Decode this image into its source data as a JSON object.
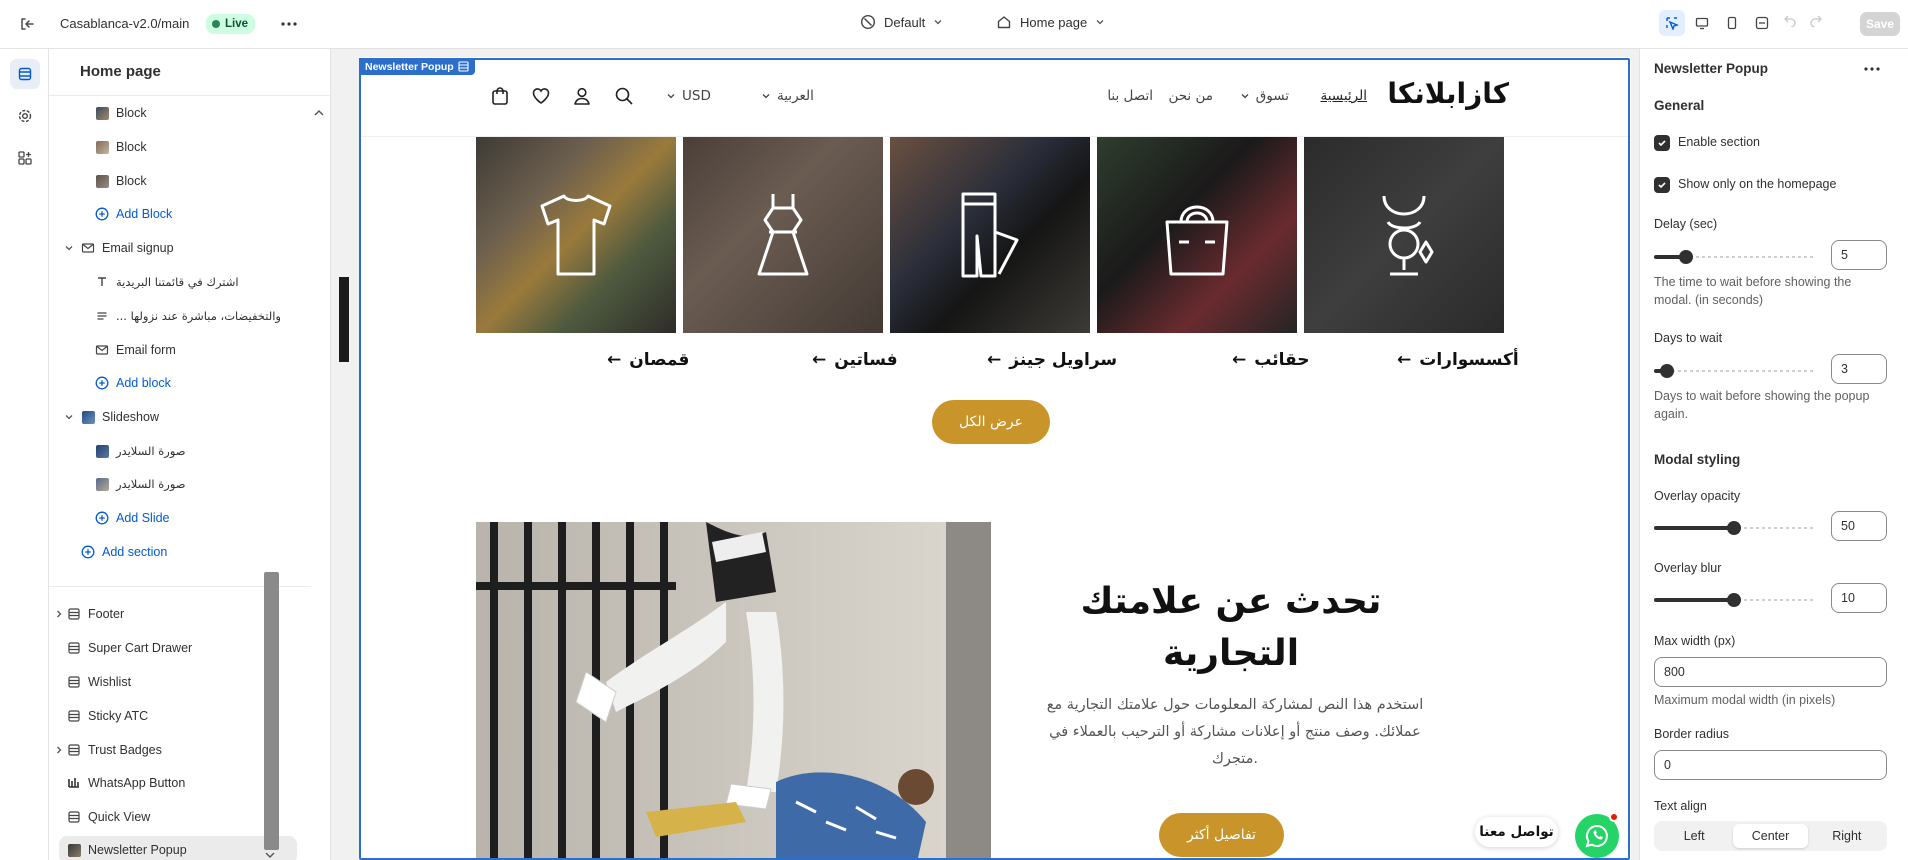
{
  "topbar": {
    "store_name": "Casablanca-v2.0/main",
    "live_badge": "Live",
    "theme_select": "Default",
    "page_select": "Home page",
    "save_label": "Save"
  },
  "left_panel": {
    "title": "Home page",
    "tree": [
      {
        "key": "block1",
        "label": "Block",
        "type": "block"
      },
      {
        "key": "block2",
        "label": "Block",
        "type": "block"
      },
      {
        "key": "block3",
        "label": "Block",
        "type": "block"
      },
      {
        "key": "add_block_1",
        "label": "Add Block",
        "type": "add"
      },
      {
        "key": "email_signup",
        "label": "Email signup",
        "type": "section"
      },
      {
        "key": "email_heading",
        "label": "اشترك في قائمتنا البريدية",
        "type": "text"
      },
      {
        "key": "email_text",
        "label": "... والتخفيضات، مباشرة عند نزولها",
        "type": "paragraph"
      },
      {
        "key": "email_form",
        "label": "Email form",
        "type": "form"
      },
      {
        "key": "add_block_2",
        "label": "Add block",
        "type": "add"
      },
      {
        "key": "slideshow",
        "label": "Slideshow",
        "type": "section"
      },
      {
        "key": "slide1",
        "label": "صورة السلايدر",
        "type": "slide"
      },
      {
        "key": "slide2",
        "label": "صورة السلايدر",
        "type": "slide"
      },
      {
        "key": "add_slide",
        "label": "Add Slide",
        "type": "add"
      },
      {
        "key": "add_section",
        "label": "Add section",
        "type": "add"
      }
    ],
    "footer_group": [
      {
        "label": "Footer"
      },
      {
        "label": "Super Cart Drawer"
      },
      {
        "label": "Wishlist"
      },
      {
        "label": "Sticky ATC"
      },
      {
        "label": "Trust Badges"
      },
      {
        "label": "WhatsApp Button"
      },
      {
        "label": "Quick View"
      },
      {
        "label": "Newsletter Popup"
      }
    ]
  },
  "canvas": {
    "selection_tag": "Newsletter Popup",
    "store": {
      "logo": "كازابلانكا",
      "nav": [
        "الرئيسية",
        "تسوق",
        "من نحن",
        "اتصل بنا"
      ],
      "language": "العربية",
      "currency": "USD",
      "categories": [
        "أكسسوارات",
        "حقائب",
        "سراويل جينز",
        "فساتين",
        "قمصان"
      ],
      "view_all": "عرض الكل",
      "story_title": "تحدث عن علامتك التجارية",
      "story_body": "استخدم هذا النص لمشاركة المعلومات حول علامتك التجارية مع عملائك. وصف منتج أو إعلانات مشاركة أو الترحيب بالعملاء في متجرك.",
      "story_button": "تفاصيل أكثر",
      "whatsapp_label": "تواصل معنا"
    }
  },
  "right_panel": {
    "title": "Newsletter Popup",
    "general_heading": "General",
    "enable_section": {
      "label": "Enable section",
      "checked": true
    },
    "homepage_only": {
      "label": "Show only on the homepage",
      "checked": true
    },
    "delay": {
      "label": "Delay (sec)",
      "value": "5",
      "fraction": 0.2,
      "help": "The time to wait before showing the modal. (in seconds)"
    },
    "days": {
      "label": "Days to wait",
      "value": "3",
      "fraction": 0.08,
      "help": "Days to wait before showing the popup again."
    },
    "modal_heading": "Modal styling",
    "overlay_opacity": {
      "label": "Overlay opacity",
      "value": "50",
      "fraction": 0.5
    },
    "overlay_blur": {
      "label": "Overlay blur",
      "value": "10",
      "fraction": 0.5
    },
    "max_width": {
      "label": "Max width (px)",
      "value": "800",
      "help": "Maximum modal width (in pixels)"
    },
    "border_radius": {
      "label": "Border radius",
      "value": "0"
    },
    "text_align": {
      "label": "Text align",
      "options": [
        "Left",
        "Center",
        "Right"
      ],
      "selected": "Center"
    }
  },
  "colors": {
    "accent": "#2c6ecb",
    "gold": "#c9952a",
    "whatsapp": "#25d366",
    "live_bg": "#cdfee1"
  }
}
